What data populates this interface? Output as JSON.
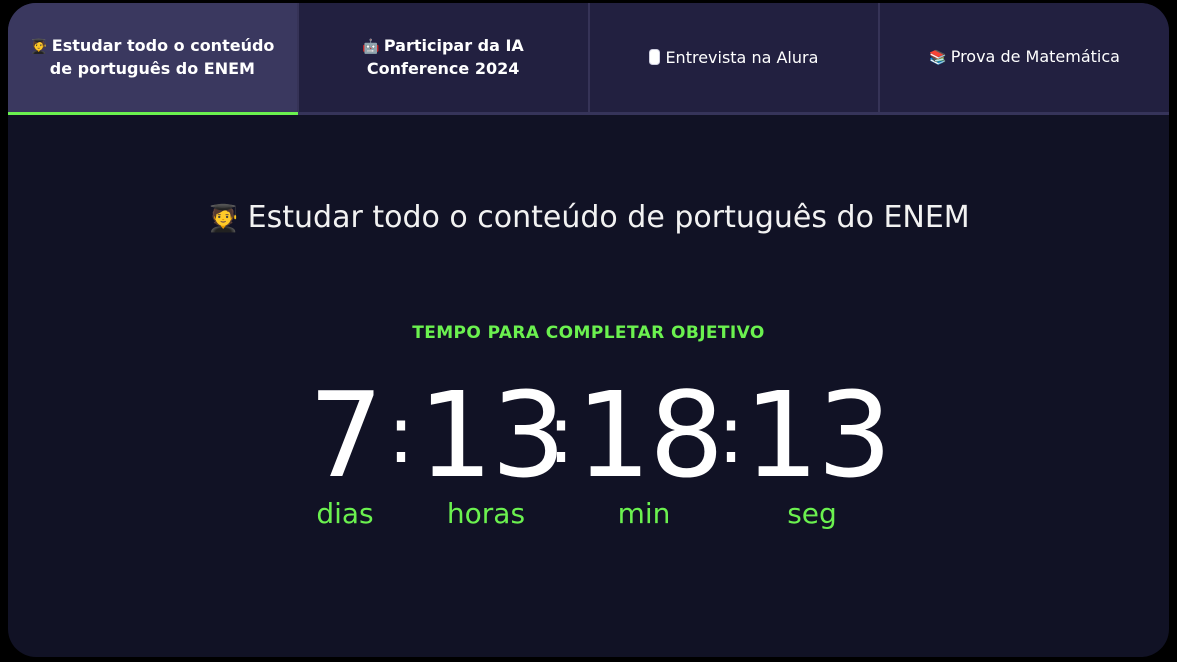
{
  "tabs": [
    {
      "emoji": "🧑‍🎓",
      "label": "Estudar todo o conteúdo de português do ENEM",
      "active": true
    },
    {
      "emoji": "🤖",
      "label": "Participar da IA Conference 2024",
      "active": false
    },
    {
      "emoji": "",
      "label": "Entrevista na Alura",
      "active": false
    },
    {
      "emoji": "📚",
      "label": "Prova de Matemática",
      "active": false
    }
  ],
  "objective": {
    "emoji": "🧑‍🎓",
    "title": "Estudar todo o conteúdo de português do ENEM"
  },
  "timer": {
    "label": "TEMPO PARA COMPLETAR OBJETIVO",
    "days": "7",
    "days_label": "dias",
    "hours": "13",
    "hours_label": "horas",
    "minutes": "18",
    "minutes_label": "min",
    "seconds": "13",
    "seconds_label": "seg",
    "separator": ":"
  },
  "colors": {
    "background": "#111225",
    "tab_bar": "#222040",
    "tab_active": "#3a385f",
    "accent": "#6bf14f"
  }
}
